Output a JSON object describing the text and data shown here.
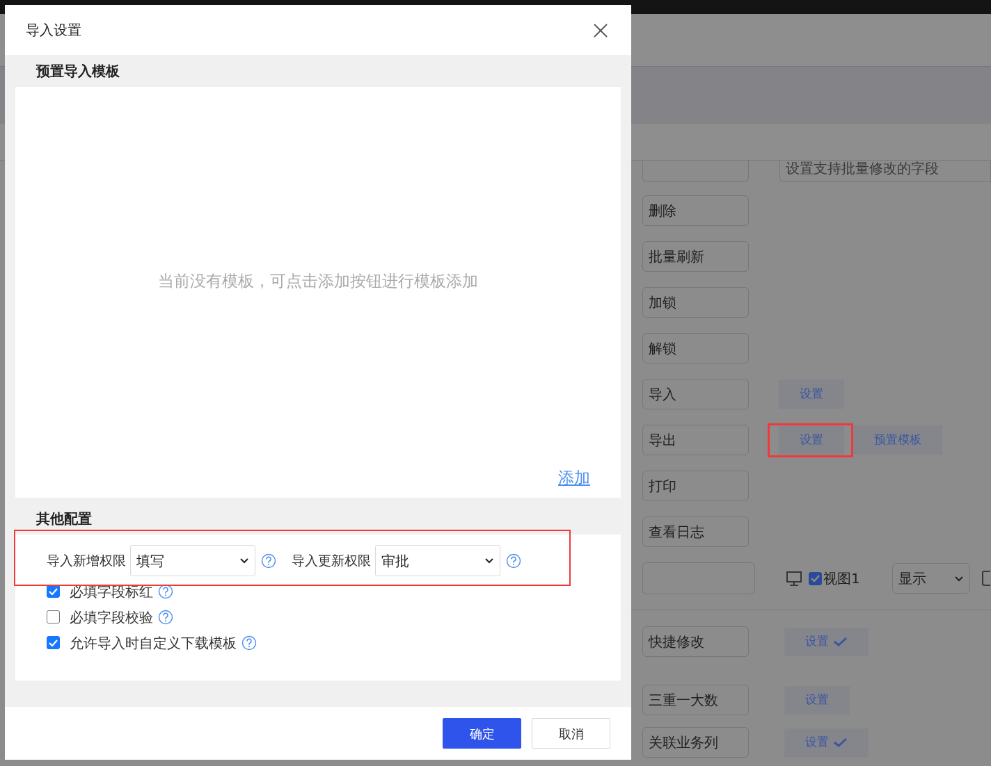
{
  "background": {
    "batch_field_placeholder": "设置支持批量修改的字段",
    "actions": [
      {
        "label": "删除"
      },
      {
        "label": "批量刷新"
      },
      {
        "label": "加锁"
      },
      {
        "label": "解锁"
      },
      {
        "label": "导入",
        "settings": [
          {
            "label": "设置",
            "confirmed": false,
            "highlighted": false
          }
        ]
      },
      {
        "label": "导出",
        "settings": [
          {
            "label": "设置",
            "confirmed": false,
            "highlighted": true
          },
          {
            "label": "预置模板",
            "confirmed": false,
            "highlighted": false
          }
        ]
      },
      {
        "label": "打印"
      },
      {
        "label": "查看日志"
      }
    ],
    "view_row": {
      "view_checked": true,
      "view_label": "视图1",
      "display_value": "显示"
    },
    "lower_actions": [
      {
        "label": "快捷修改",
        "settings": [
          {
            "label": "设置",
            "confirmed": true,
            "highlighted": false
          }
        ]
      },
      {
        "label": "三重一大数",
        "settings": [
          {
            "label": "设置",
            "confirmed": false,
            "highlighted": false
          }
        ]
      },
      {
        "label": "关联业务列",
        "settings": [
          {
            "label": "设置",
            "confirmed": true,
            "highlighted": false
          }
        ]
      }
    ]
  },
  "dialog": {
    "title": "导入设置",
    "template_section": {
      "title": "预置导入模板",
      "empty_message": "当前没有模板，可点击添加按钮进行模板添加",
      "add_link": "添加"
    },
    "other_section": {
      "title": "其他配置",
      "permissions_highlighted": true,
      "permissions": [
        {
          "label": "导入新增权限",
          "value": "填写"
        },
        {
          "label": "导入更新权限",
          "value": "审批"
        }
      ],
      "options": [
        {
          "label": "必填字段标红",
          "checked": true
        },
        {
          "label": "必填字段校验",
          "checked": false
        },
        {
          "label": "允许导入时自定义下载模板",
          "checked": true
        }
      ]
    },
    "buttons": [
      {
        "label": "确定",
        "kind": "primary"
      },
      {
        "label": "取消",
        "kind": "secondary"
      }
    ]
  }
}
